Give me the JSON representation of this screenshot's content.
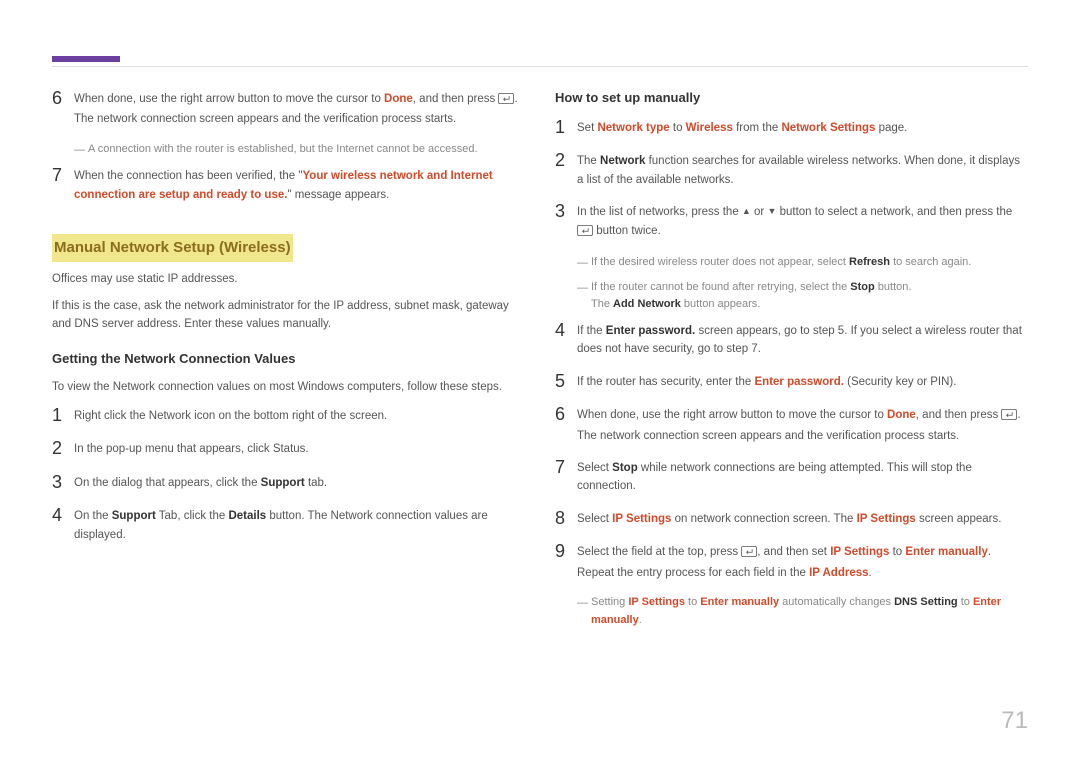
{
  "pageNumber": "71",
  "left": {
    "step6_a": "When done, use the right arrow button to move the cursor to ",
    "step6_done": "Done",
    "step6_b": ", and then press ",
    "step6_c": ". The network connection screen appears and the verification process starts.",
    "note1": "A connection with the router is established, but the Internet cannot be accessed.",
    "step7_a": "When the connection has been verified, the \"",
    "step7_msg": "Your wireless network and Internet connection are setup and ready to use.",
    "step7_b": "\" message appears.",
    "sectionTitle": "Manual Network Setup (Wireless)",
    "intro1": "Offices may use static IP addresses.",
    "intro2": "If this is the case, ask the network administrator for the IP address, subnet mask, gateway and DNS server address. Enter these values manually.",
    "sub1": "Getting the Network Connection Values",
    "sub1_intro": "To view the Network connection values on most Windows computers, follow these steps.",
    "s1": "Right click the Network icon on the bottom right of the screen.",
    "s2": "In the pop-up menu that appears, click Status.",
    "s3_a": "On the dialog that appears, click the ",
    "s3_support": "Support",
    "s3_b": " tab.",
    "s4_a": "On the ",
    "s4_b": " Tab, click the ",
    "s4_details": "Details",
    "s4_c": " button. The Network connection values are displayed."
  },
  "right": {
    "sub2": "How to set up manually",
    "r1_a": "Set ",
    "r1_nt": "Network type",
    "r1_b": " to ",
    "r1_w": "Wireless",
    "r1_c": " from the ",
    "r1_ns": "Network Settings",
    "r1_d": " page.",
    "r2_a": "The ",
    "r2_net": "Network",
    "r2_b": " function searches for available wireless networks. When done, it displays a list of the available networks.",
    "r3_a": "In the list of networks, press the ",
    "r3_b": " or ",
    "r3_c": " button to select a network, and then press the ",
    "r3_d": " button twice.",
    "r3_note1_a": "If the desired wireless router does not appear, select ",
    "r3_note1_refresh": "Refresh",
    "r3_note1_b": " to search again.",
    "r3_note2_a": "If the router cannot be found after retrying, select the ",
    "r3_note2_stop": "Stop",
    "r3_note2_b": " button.",
    "r3_note2_c_a": "The ",
    "r3_note2_addnet": "Add Network",
    "r3_note2_c_b": " button appears.",
    "r4_a": "If the ",
    "r4_ep": "Enter password.",
    "r4_b": " screen appears, go to step 5. If you select a wireless router that does not have security, go to step 7.",
    "r5_a": "If the router has security, enter the ",
    "r5_b": " (Security key or PIN).",
    "r6_a": "When done, use the right arrow button to move the cursor to ",
    "r6_b": ", and then press ",
    "r6_c": ". The network connection screen appears and the verification process starts.",
    "r7_a": "Select ",
    "r7_stop": "Stop",
    "r7_b": " while network connections are being attempted. This will stop the connection.",
    "r8_a": "Select ",
    "r8_ips": "IP Settings",
    "r8_b": " on network connection screen. The ",
    "r8_c": " screen appears.",
    "r9_a": "Select the field at the top, press ",
    "r9_b": ", and then set ",
    "r9_c": " to ",
    "r9_em": "Enter manually",
    "r9_d": ". Repeat the entry process for each field in the ",
    "r9_ip": "IP Address",
    "r9_e": ".",
    "r9_note_a": "Setting ",
    "r9_note_b": " to ",
    "r9_note_c": " automatically changes ",
    "r9_note_dns": "DNS Setting",
    "r9_note_d": " to ",
    "r9_note_e": "."
  }
}
